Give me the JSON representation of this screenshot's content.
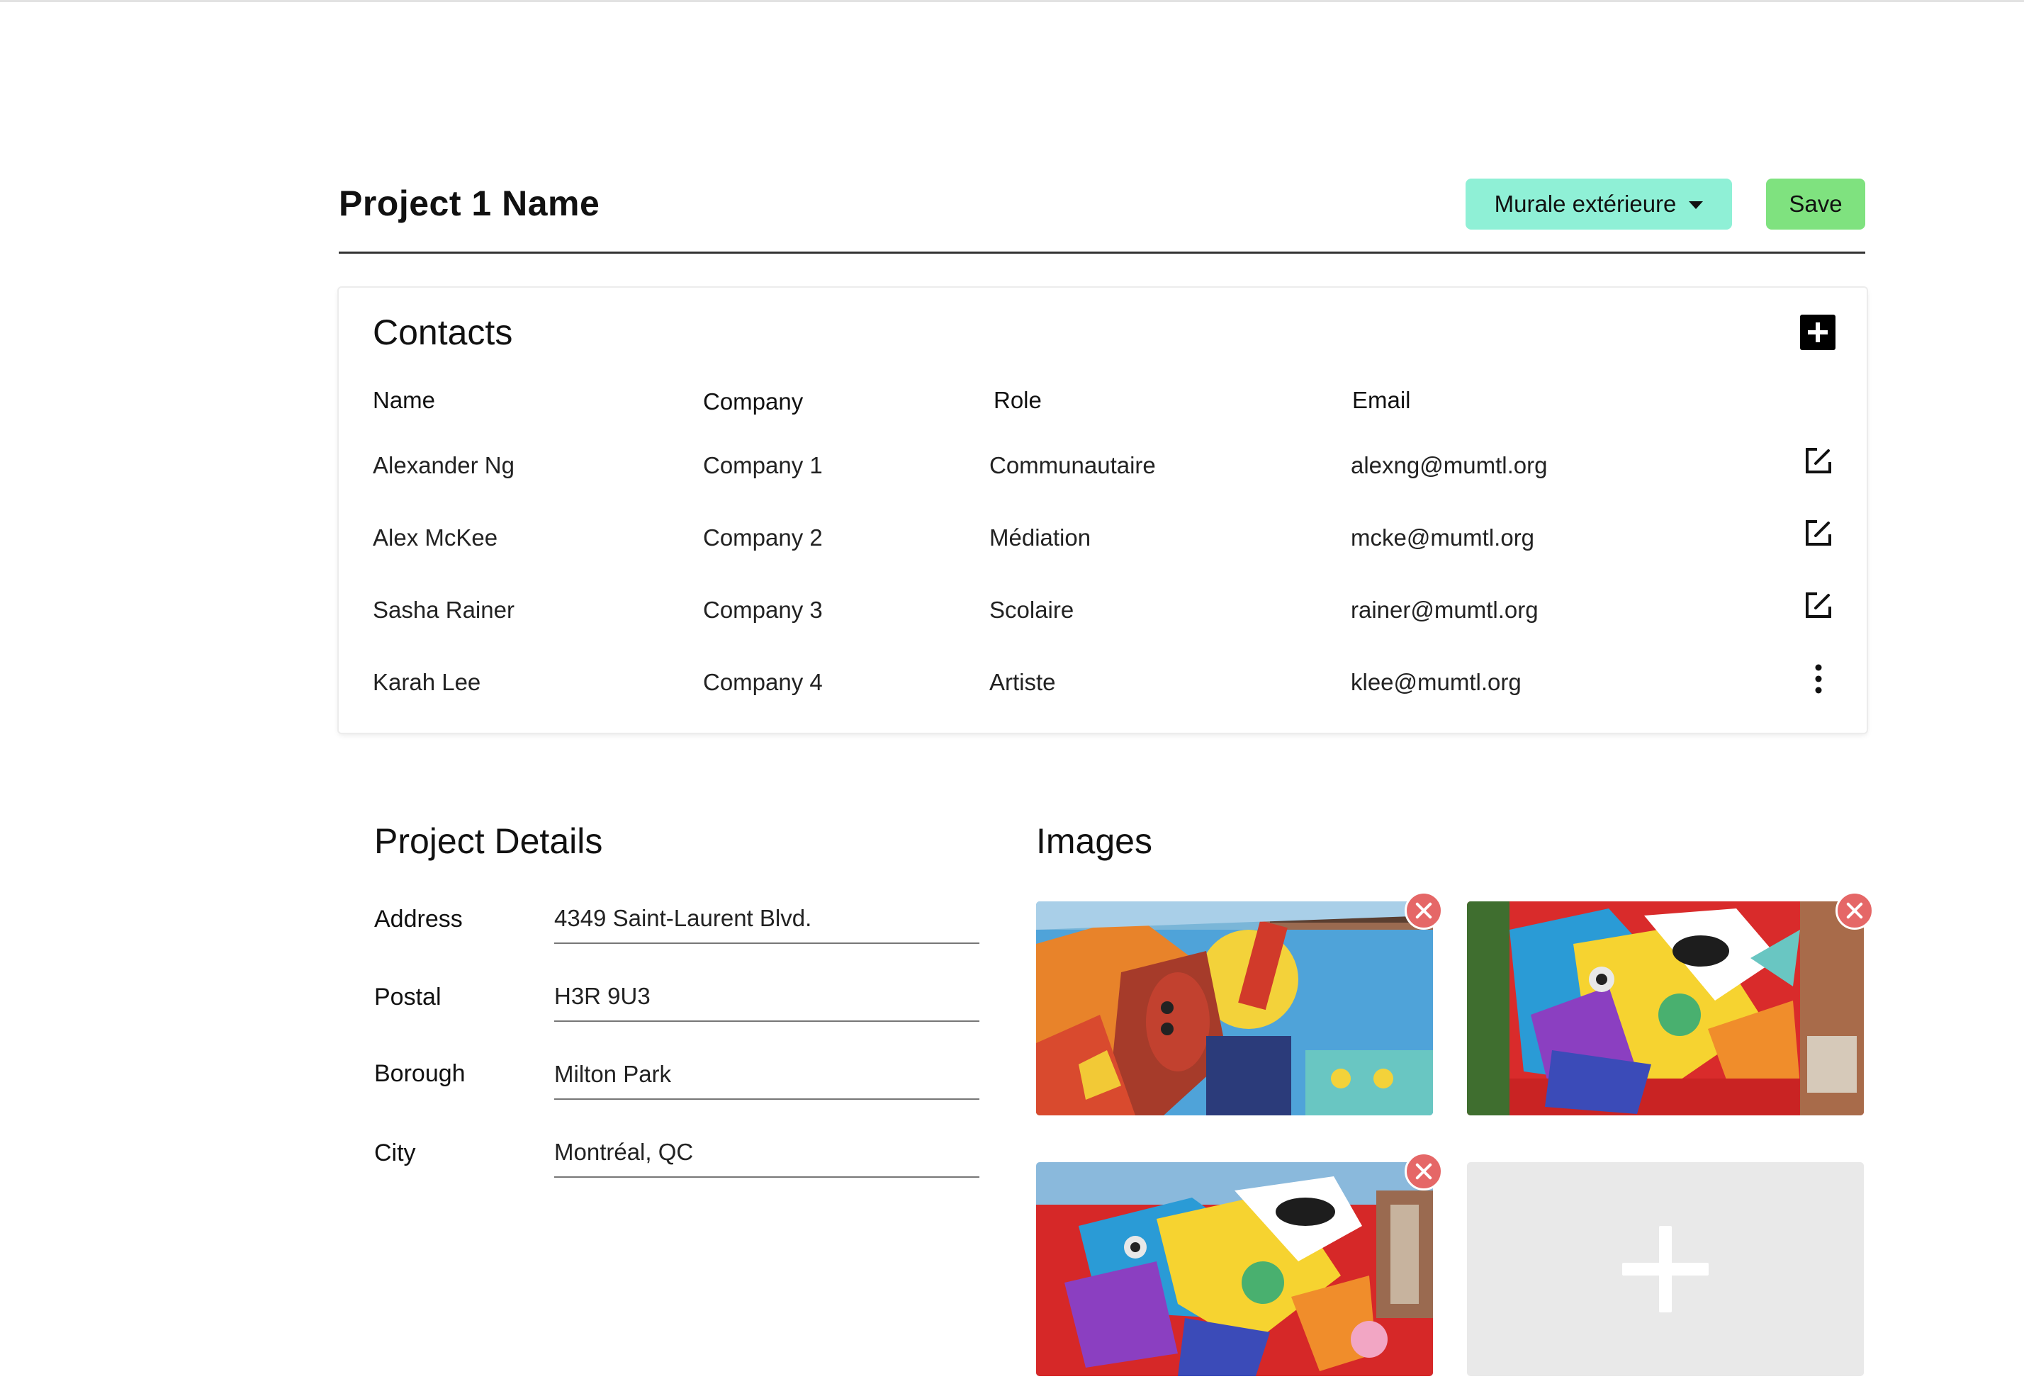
{
  "header": {
    "project_title": "Project 1 Name",
    "type_selected": "Murale extérieure",
    "save_label": "Save"
  },
  "contacts": {
    "title": "Contacts",
    "columns": {
      "name": "Name",
      "company": "Company",
      "role": "Role",
      "email": "Email"
    },
    "rows": [
      {
        "name": "Alexander Ng",
        "company": "Company 1",
        "role": "Communautaire",
        "email": "alexng@mumtl.org",
        "action_icon": "edit-icon"
      },
      {
        "name": "Alex McKee",
        "company": "Company 2",
        "role": "Médiation",
        "email": "mcke@mumtl.org",
        "action_icon": "edit-icon"
      },
      {
        "name": "Sasha Rainer",
        "company": "Company 3",
        "role": "Scolaire",
        "email": "rainer@mumtl.org",
        "action_icon": "edit-icon"
      },
      {
        "name": "Karah Lee",
        "company": "Company 4",
        "role": "Artiste",
        "email": "klee@mumtl.org",
        "action_icon": "more-vertical-icon"
      }
    ]
  },
  "details": {
    "title": "Project Details",
    "fields": [
      {
        "label": "Address",
        "value": "4349 Saint-Laurent Blvd."
      },
      {
        "label": "Postal",
        "value": "H3R 9U3"
      },
      {
        "label": "Borough",
        "value": "Milton Park"
      },
      {
        "label": "City",
        "value": "Montréal, QC"
      }
    ]
  },
  "images": {
    "title": "Images"
  },
  "colors": {
    "dropdown_bg": "#8ff0d6",
    "save_bg": "#7fe27f",
    "remove_bg": "#e56767",
    "add_tile_bg": "#e9e9e9"
  }
}
